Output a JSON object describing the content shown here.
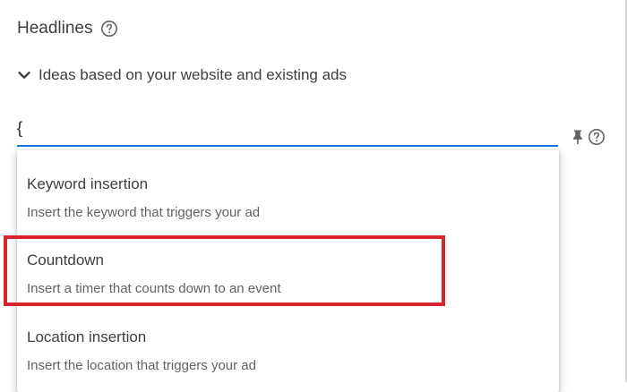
{
  "section": {
    "title": "Headlines",
    "help_icon": "help-circle-icon"
  },
  "ideas": {
    "label": "Ideas based on your website and existing ads",
    "icon": "chevron-down-icon",
    "expanded": true
  },
  "headline_input": {
    "value": "{",
    "pin_icon": "pin-icon",
    "help_icon": "help-circle-icon",
    "accent_color": "#1a73e8"
  },
  "dropdown": {
    "items": [
      {
        "title": "Keyword insertion",
        "description": "Insert the keyword that triggers your ad"
      },
      {
        "title": "Countdown",
        "description": "Insert a timer that counts down to an event"
      },
      {
        "title": "Location insertion",
        "description": "Insert the location that triggers your ad"
      }
    ]
  },
  "highlight": {
    "target": "Countdown",
    "color": "#d7252d"
  }
}
